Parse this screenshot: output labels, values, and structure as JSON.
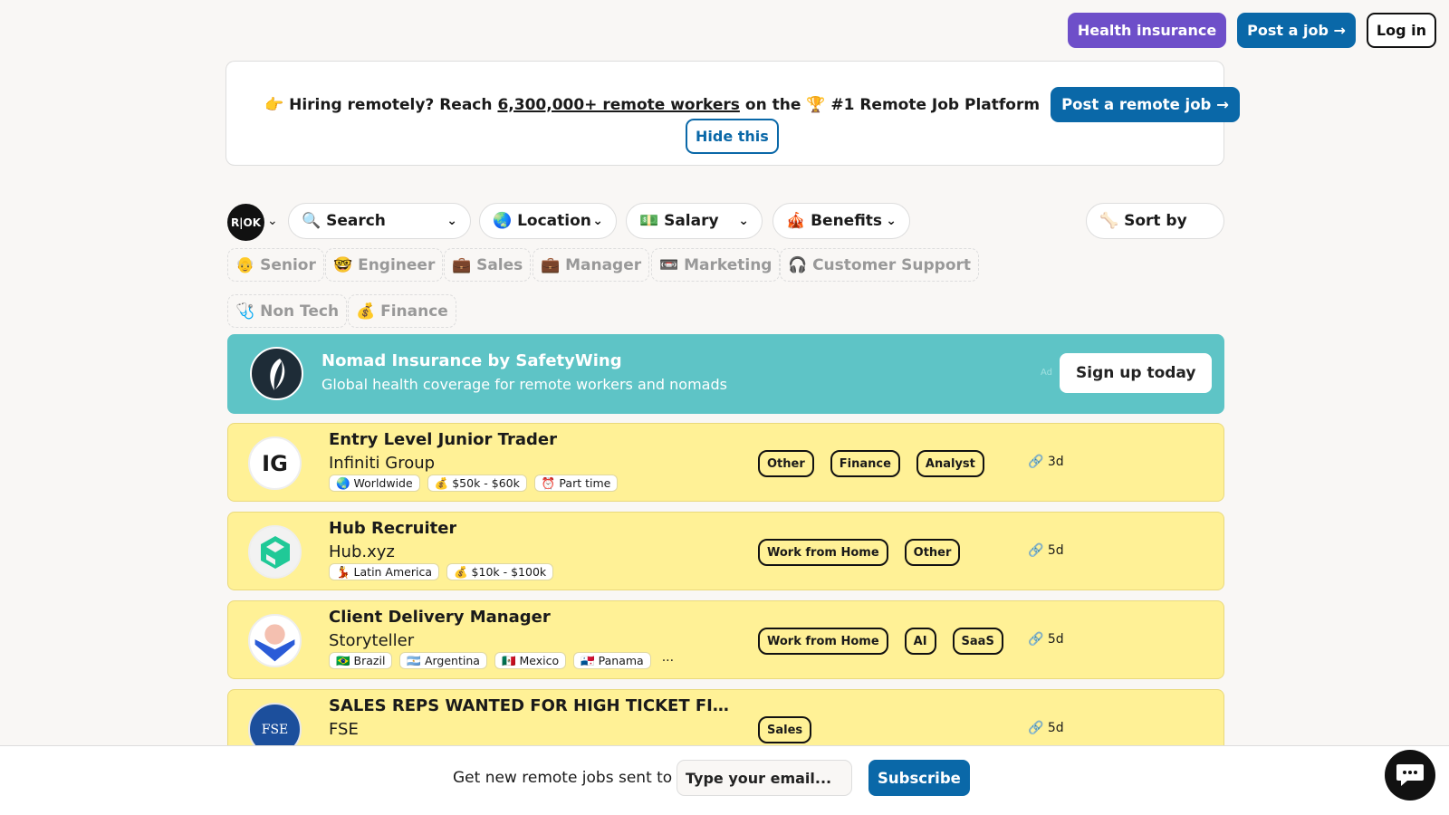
{
  "header": {
    "health_label": "Health insurance",
    "post_job_label": "Post a job →",
    "login_label": "Log in"
  },
  "banner": {
    "prefix": "👉 Hiring remotely? Reach",
    "link": "6,300,000+ remote workers",
    "suffix": "on the 🏆 #1 Remote Job Platform",
    "cta": "Post a remote job →",
    "hide": "Hide this"
  },
  "filters": {
    "logo_text": "R|OK",
    "search": "🔍 Search",
    "location": "🌏 Location",
    "salary": "💵 Salary",
    "benefits": "🎪 Benefits",
    "sort": "🦴 Sort by"
  },
  "quick_tags": [
    "👴 Senior",
    "🤓 Engineer",
    "💼 Sales",
    "💼 Manager",
    "📼 Marketing",
    "🎧 Customer Support",
    "🩺 Non Tech",
    "💰 Finance"
  ],
  "ad": {
    "title": "Nomad Insurance by SafetyWing",
    "subtitle": "Global health coverage for remote workers and nomads",
    "label": "Ad",
    "cta": "Sign up today"
  },
  "jobs": [
    {
      "title": "Entry Level Junior Trader",
      "company": "Infiniti Group",
      "logo_text": "IG",
      "meta": [
        "🌏 Worldwide",
        "💰 $50k - $60k",
        "⏰ Part time"
      ],
      "tags": [
        "Other",
        "Finance",
        "Analyst"
      ],
      "time": "🔗 3d"
    },
    {
      "title": "Hub Recruiter",
      "company": "Hub.xyz",
      "meta": [
        "💃 Latin America",
        "💰 $10k - $100k"
      ],
      "tags": [
        "Work from Home",
        "Other"
      ],
      "time": "🔗 5d"
    },
    {
      "title": "Client Delivery Manager",
      "company": "Storyteller",
      "meta": [
        "🇧🇷 Brazil",
        "🇦🇷 Argentina",
        "🇲🇽 Mexico",
        "🇵🇦 Panama"
      ],
      "more": "···",
      "tags": [
        "Work from Home",
        "AI",
        "SaaS"
      ],
      "time": "🔗 5d"
    },
    {
      "title": "SALES REPS WANTED FOR HIGH TICKET FINANCE",
      "company": "FSE",
      "logo_text": "FSE",
      "tags": [
        "Sales"
      ],
      "time": "🔗 5d"
    }
  ],
  "footer": {
    "text": "Get new remote jobs sent to",
    "placeholder": "Type your email...",
    "subscribe": "Subscribe"
  }
}
